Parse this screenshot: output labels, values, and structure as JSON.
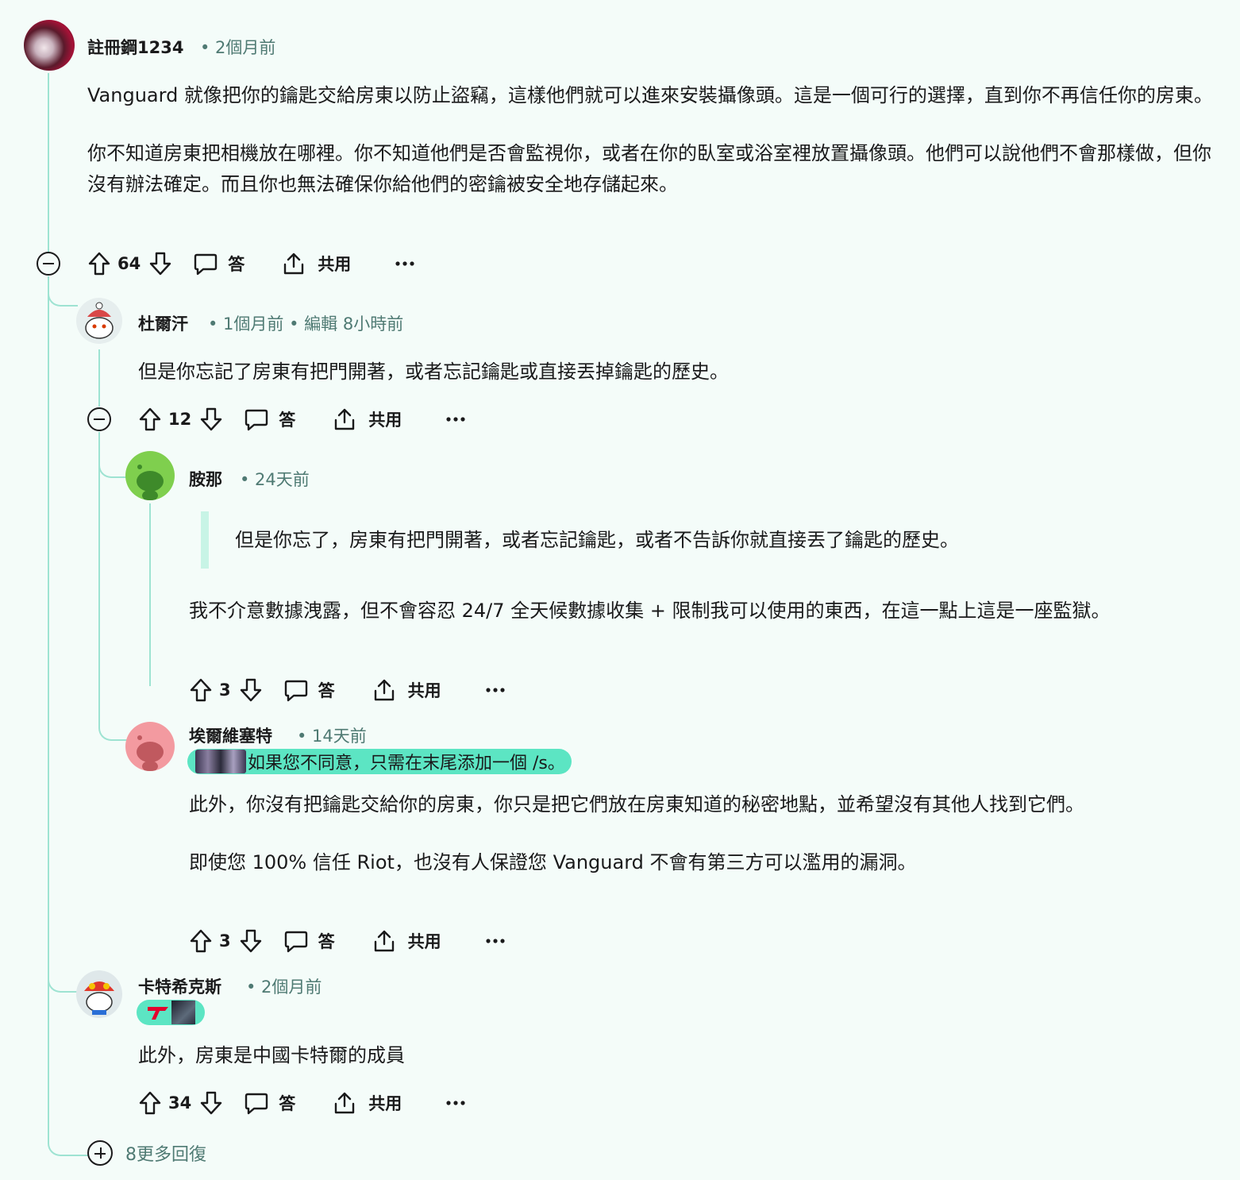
{
  "accent_color": "#9ee3d2",
  "flair_color": "#5ce5c3",
  "labels": {
    "reply": "答",
    "share": "共用"
  },
  "comments": [
    {
      "author": "註冊鋼1234",
      "time": "• 2個月前",
      "body": [
        "Vanguard 就像把你的鑰匙交給房東以防止盜竊，這樣他們就可以進來安裝攝像頭。這是一個可行的選擇，直到你不再信任你的房東。",
        "你不知道房東把相機放在哪裡。你不知道他們是否會監視你，或者在你的臥室或浴室裡放置攝像頭。他們可以說他們不會那樣做，但你沒有辦法確定。而且你也無法確保你給他們的密鑰被安全地存儲起來。"
      ],
      "score": "64"
    },
    {
      "author": "杜爾汗",
      "time": "• 1個月前 • 編輯 8小時前",
      "body": [
        "但是你忘記了房東有把門開著，或者忘記鑰匙或直接丟掉鑰匙的歷史。"
      ],
      "score": "12"
    },
    {
      "author": "胺那",
      "time": "• 24天前",
      "quote": "但是你忘了，房東有把門開著，或者忘記鑰匙，或者不告訴你就直接丟了鑰匙的歷史。",
      "body": [
        "我不介意數據洩露，但不會容忍 24/7 全天候數據收集 + 限制我可以使用的東西，在這一點上這是一座監獄。"
      ],
      "score": "3"
    },
    {
      "author": "埃爾維塞特",
      "time": "• 14天前",
      "flair": "如果您不同意，只需在末尾添加一個 /s。",
      "body": [
        "此外，你沒有把鑰匙交給你的房東，你只是把它們放在房東知道的秘密地點，並希望沒有其他人找到它們。",
        "即使您 100% 信任 Riot，也沒有人保證您 Vanguard 不會有第三方可以濫用的漏洞。"
      ],
      "score": "3"
    },
    {
      "author": "卡特希克斯",
      "time": "• 2個月前",
      "body": [
        "此外，房東是中國卡特爾的成員"
      ],
      "score": "34"
    }
  ],
  "more_replies": "8更多回復"
}
